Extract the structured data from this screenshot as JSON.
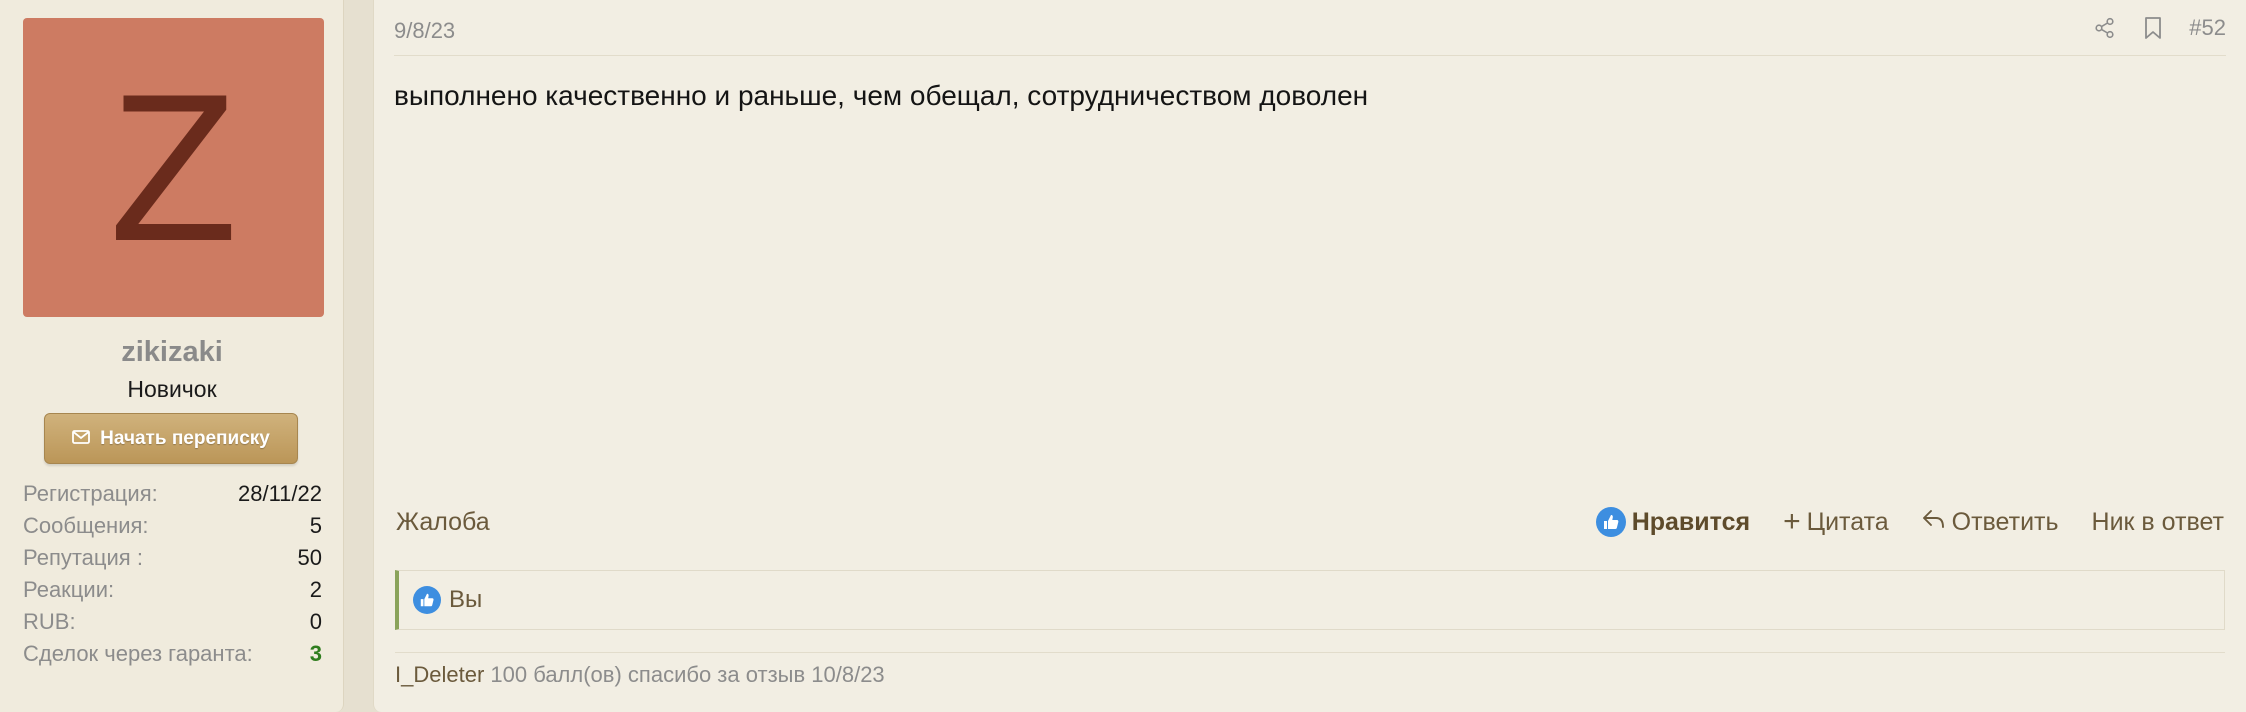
{
  "user": {
    "avatar_letter": "Z",
    "avatar_color": "#cd7b62",
    "name": "zikizaki",
    "title": "Новичок",
    "pm_button": "Начать переписку",
    "stats": [
      {
        "label": "Регистрация:",
        "value": "28/11/22"
      },
      {
        "label": "Сообщения:",
        "value": "5"
      },
      {
        "label": "Репутация :",
        "value": "50"
      },
      {
        "label": "Реакции:",
        "value": "2"
      },
      {
        "label": "RUB:",
        "value": "0"
      },
      {
        "label": "Сделок через гаранта:",
        "value": "3"
      }
    ]
  },
  "post": {
    "date": "9/8/23",
    "number": "#52",
    "text": "выполнено качественно и раньше, чем обещал, сотрудничеством доволен",
    "icons": [
      "share-icon",
      "bookmark-icon"
    ]
  },
  "actions": {
    "report": "Жалоба",
    "like": "Нравится",
    "quote_prefix": "+",
    "quote": "Цитата",
    "reply": "Ответить",
    "nick_reply": "Ник в ответ"
  },
  "reactions": {
    "who": "Вы"
  },
  "footer": {
    "user": "I_Deleter",
    "note": "100 балл(ов) спасибо за отзыв 10/8/23"
  },
  "colors": {
    "accent_green": "#2f7d1e",
    "like_blue": "#3d8ee0",
    "button_gold": "#c4a266"
  }
}
